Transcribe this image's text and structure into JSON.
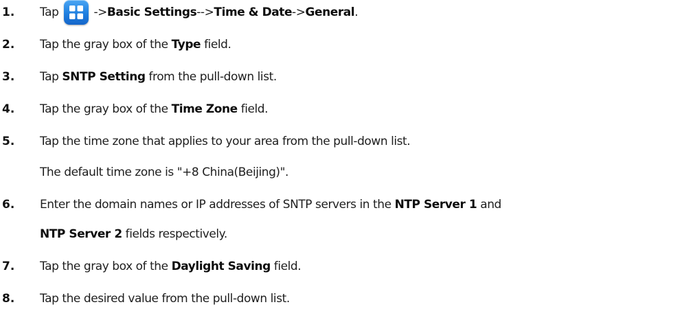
{
  "steps": [
    {
      "number": "1.",
      "parts": {
        "a": "Tap",
        "b": " ->",
        "c": "Basic Settings",
        "d": "-->",
        "e": "Time & Date",
        "f": "->",
        "g": "General",
        "h": "."
      },
      "icon": "apps-menu-icon"
    },
    {
      "number": "2.",
      "parts": {
        "a": "Tap the gray box of the ",
        "b": "Type",
        "c": " field."
      }
    },
    {
      "number": "3.",
      "parts": {
        "a": "Tap ",
        "b": "SNTP Setting",
        "c": " from the pull-down list."
      }
    },
    {
      "number": "4.",
      "parts": {
        "a": "Tap the gray box of the ",
        "b": "Time Zone",
        "c": " field."
      }
    },
    {
      "number": "5.",
      "parts": {
        "a": "Tap the time zone that applies to your area from the pull-down list."
      },
      "sub": "The default time zone is \"+8 China(Beijing)\"."
    },
    {
      "number": "6.",
      "parts": {
        "a": "Enter the domain names or IP addresses of SNTP servers in the ",
        "b": "NTP Server 1",
        "c": " and"
      },
      "sub_parts": {
        "a": "NTP Server 2",
        "b": " fields respectively."
      }
    },
    {
      "number": "7.",
      "parts": {
        "a": "Tap the gray box of the ",
        "b": "Daylight Saving",
        "c": " field."
      }
    },
    {
      "number": "8.",
      "parts": {
        "a": "Tap the desired value from the pull-down list."
      }
    }
  ],
  "colors": {
    "icon_top": "#4aa6f4",
    "icon_bottom": "#1566c9",
    "text": "#1e1e1e"
  }
}
